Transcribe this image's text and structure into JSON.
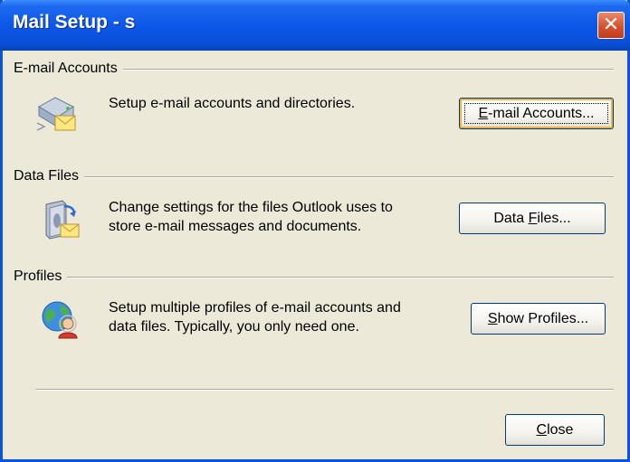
{
  "window": {
    "title": "Mail Setup - s",
    "close_glyph": "✕"
  },
  "sections": [
    {
      "label": "E-mail Accounts",
      "description": [
        "Setup e-mail accounts and directories."
      ],
      "button": {
        "before": "",
        "mnemonic": "E",
        "after": "-mail Accounts..."
      },
      "icon": "email-server-envelope-icon"
    },
    {
      "label": "Data Files",
      "description": [
        "Change settings for the files Outlook uses to",
        "store e-mail messages and documents."
      ],
      "button": {
        "before": "Data ",
        "mnemonic": "F",
        "after": "iles..."
      },
      "icon": "data-file-mail-icon"
    },
    {
      "label": "Profiles",
      "description": [
        "Setup multiple profiles of e-mail accounts and",
        "data files. Typically, you only need one."
      ],
      "button": {
        "before": "",
        "mnemonic": "S",
        "after": "how Profiles..."
      },
      "icon": "globe-user-profile-icon"
    }
  ],
  "footer": {
    "close_button": {
      "before": "",
      "mnemonic": "C",
      "after": "lose"
    }
  },
  "colors": {
    "titlebar": "#0A53E0",
    "dialog_bg": "#ECE9D8",
    "button_border": "#003C74",
    "close_red": "#D6522F"
  }
}
